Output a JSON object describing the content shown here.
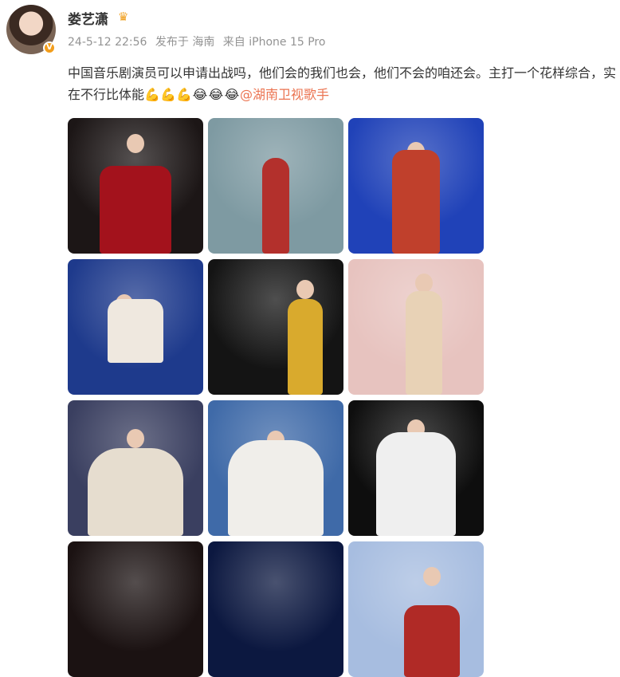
{
  "post": {
    "username": "娄艺潇",
    "crown_icon": "crown-icon",
    "verified_badge": "V",
    "timestamp": "24-5-12 22:56",
    "location": "发布于 海南",
    "device": "来自 iPhone 15 Pro",
    "text": "中国音乐剧演员可以申请出战吗，他们会的我们也会，他们不会的咱还会。主打一个花样综合，实在不行比体能",
    "emojis_muscle": [
      "💪",
      "💪",
      "💪"
    ],
    "emojis_face": [
      "😂",
      "😂",
      "😂"
    ],
    "mention": "@湖南卫视歌手"
  },
  "photos": [
    {
      "name": "photo-red-rose-dress",
      "bg": "#1c1616",
      "accent": "#a3121c"
    },
    {
      "name": "photo-stage-red-skirt",
      "bg": "#7e9aa2",
      "accent": "#b3302c"
    },
    {
      "name": "photo-blue-stage-singer",
      "bg": "#2042b8",
      "accent": "#c0402c"
    },
    {
      "name": "photo-blue-spotlight-seated",
      "bg": "#1e3a8c",
      "accent": "#efe8df"
    },
    {
      "name": "photo-yellow-dress-dark",
      "bg": "#141414",
      "accent": "#d9aa2d"
    },
    {
      "name": "photo-pink-pillars",
      "bg": "#e7c3bf",
      "accent": "#e8d2b6"
    },
    {
      "name": "photo-group-dance",
      "bg": "#3a3f60",
      "accent": "#e6ddcf"
    },
    {
      "name": "photo-blue-ensemble",
      "bg": "#3f6aa8",
      "accent": "#f0eeea"
    },
    {
      "name": "photo-couple-embrace",
      "bg": "#0e0e0e",
      "accent": "#efefef"
    },
    {
      "name": "photo-dark-stage-1",
      "bg": "#1b1212",
      "accent": "#3a2a22"
    },
    {
      "name": "photo-dark-blue-stage",
      "bg": "#0c1840",
      "accent": "#2b4a9a"
    },
    {
      "name": "photo-snow-ethnic-costume",
      "bg": "#a7bde0",
      "accent": "#b02a26"
    }
  ]
}
